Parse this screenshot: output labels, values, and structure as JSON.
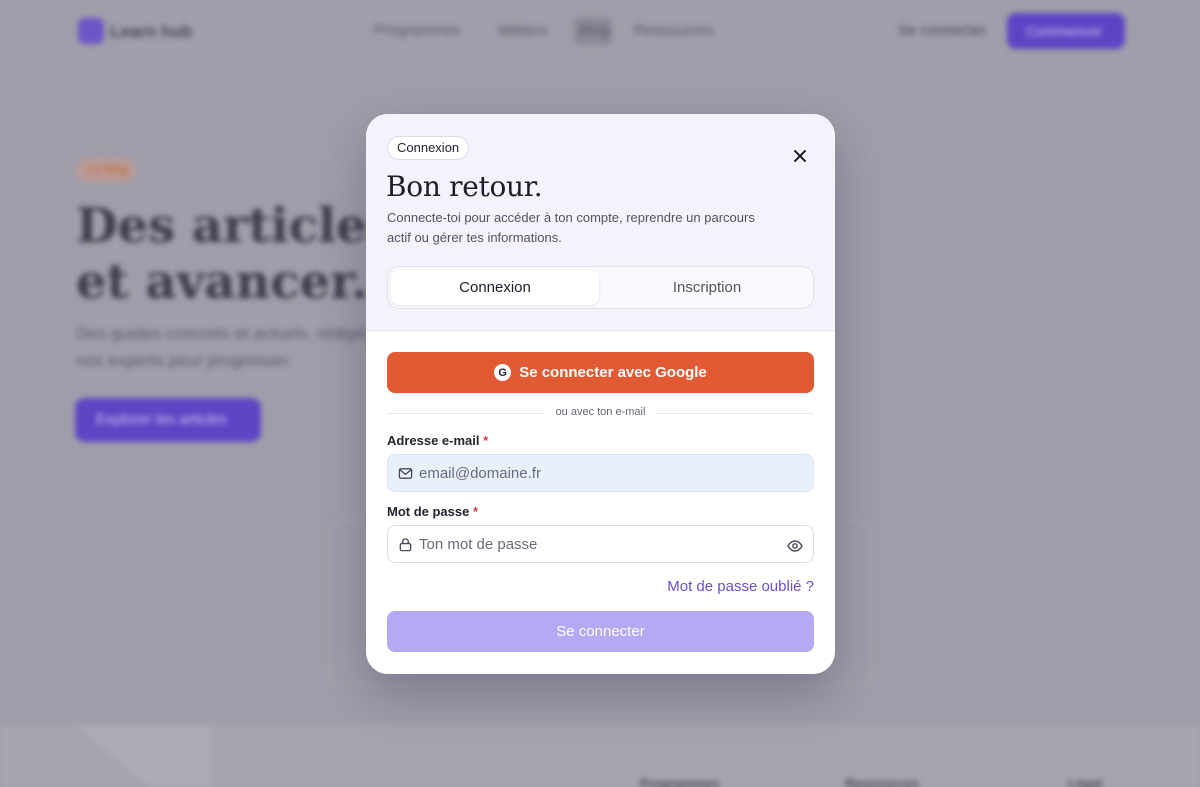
{
  "background": {
    "logo_text": "Learn hub",
    "nav": [
      {
        "label": "Programmes"
      },
      {
        "label": "Métiers"
      },
      {
        "label": "Blog"
      },
      {
        "label": "Ressources"
      }
    ],
    "login_link": "Se connecter",
    "cta_label": "Commencer",
    "badge": "Le blog",
    "hero_line1": "Des articles pour",
    "hero_line2": "et avancer.",
    "sub_line1": "Des guides concrets et actuels, rédigés par",
    "sub_line2": "nos experts pour progresser.",
    "hero_button": "Explorer les articles",
    "footer_cols": [
      "Programmes",
      "Ressources",
      "Légal"
    ]
  },
  "modal": {
    "chip": "Connexion",
    "title": "Bon retour.",
    "subtitle": "Connecte-toi pour accéder à ton compte, reprendre un parcours actif ou gérer tes informations.",
    "tabs": {
      "login": "Connexion",
      "signup": "Inscription"
    },
    "google_button": "Se connecter avec Google",
    "google_letter": "G",
    "divider": "ou avec ton e-mail",
    "email": {
      "label": "Adresse e-mail",
      "required_mark": "*",
      "value": "",
      "placeholder": "email@domaine.fr"
    },
    "password": {
      "label": "Mot de passe",
      "required_mark": "*",
      "value": "",
      "placeholder": "Ton mot de passe"
    },
    "forgot_link": "Mot de passe oublié ?",
    "submit_label": "Se connecter"
  },
  "colors": {
    "accent": "#6b4fd0",
    "google": "#e25a34",
    "submit_disabled": "#b6a8f2",
    "required": "#d63b3b"
  },
  "icons": {
    "close": "close-icon",
    "email": "mail-icon",
    "password": "lock-icon",
    "reveal": "eye-icon",
    "google": "google-icon"
  }
}
